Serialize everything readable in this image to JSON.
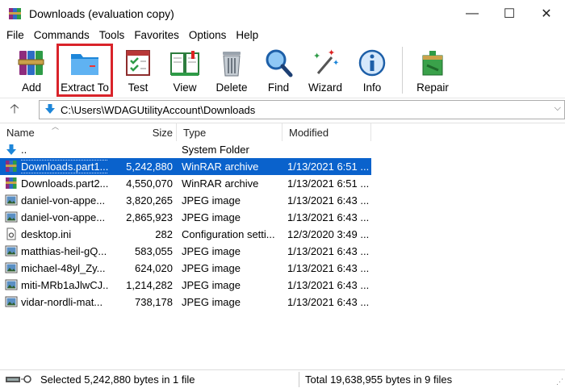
{
  "window": {
    "title": "Downloads (evaluation copy)",
    "minimize_glyph": "—",
    "maximize_glyph": "☐",
    "close_glyph": "✕"
  },
  "menu": [
    "File",
    "Commands",
    "Tools",
    "Favorites",
    "Options",
    "Help"
  ],
  "toolbar": [
    {
      "label": "Add",
      "icon": "books-archive-icon"
    },
    {
      "label": "Extract To",
      "icon": "folder-extract-icon",
      "highlighted": true
    },
    {
      "label": "Test",
      "icon": "checklist-icon"
    },
    {
      "label": "View",
      "icon": "open-book-icon"
    },
    {
      "label": "Delete",
      "icon": "trash-can-icon"
    },
    {
      "label": "Find",
      "icon": "magnifier-icon"
    },
    {
      "label": "Wizard",
      "icon": "magic-wand-icon"
    },
    {
      "label": "Info",
      "icon": "info-icon"
    },
    {
      "label": "Repair",
      "icon": "first-aid-box-icon"
    }
  ],
  "address": {
    "up_glyph": "🡡",
    "path": "C:\\Users\\WDAGUtilityAccount\\Downloads",
    "dropdown_glyph": "⌵"
  },
  "columns": {
    "name": "Name",
    "size": "Size",
    "type": "Type",
    "modified": "Modified"
  },
  "files": [
    {
      "name": "..",
      "size": "",
      "type": "System Folder",
      "modified": "",
      "icon": "folder-up-icon",
      "selected": false
    },
    {
      "name": "Downloads.part1...",
      "size": "5,242,880",
      "type": "WinRAR archive",
      "modified": "1/13/2021 6:51 ...",
      "icon": "rar-archive-icon",
      "selected": true
    },
    {
      "name": "Downloads.part2...",
      "size": "4,550,070",
      "type": "WinRAR archive",
      "modified": "1/13/2021 6:51 ...",
      "icon": "rar-archive-icon",
      "selected": false
    },
    {
      "name": "daniel-von-appe...",
      "size": "3,820,265",
      "type": "JPEG image",
      "modified": "1/13/2021 6:43 ...",
      "icon": "image-file-icon",
      "selected": false
    },
    {
      "name": "daniel-von-appe...",
      "size": "2,865,923",
      "type": "JPEG image",
      "modified": "1/13/2021 6:43 ...",
      "icon": "image-file-icon",
      "selected": false
    },
    {
      "name": "desktop.ini",
      "size": "282",
      "type": "Configuration setti...",
      "modified": "12/3/2020 3:49 ...",
      "icon": "config-file-icon",
      "selected": false
    },
    {
      "name": "matthias-heil-gQ...",
      "size": "583,055",
      "type": "JPEG image",
      "modified": "1/13/2021 6:43 ...",
      "icon": "image-file-icon",
      "selected": false
    },
    {
      "name": "michael-48yl_Zy...",
      "size": "624,020",
      "type": "JPEG image",
      "modified": "1/13/2021 6:43 ...",
      "icon": "image-file-icon",
      "selected": false
    },
    {
      "name": "miti-MRb1aJlwCJ...",
      "size": "1,214,282",
      "type": "JPEG image",
      "modified": "1/13/2021 6:43 ...",
      "icon": "image-file-icon",
      "selected": false
    },
    {
      "name": "vidar-nordli-mat...",
      "size": "738,178",
      "type": "JPEG image",
      "modified": "1/13/2021 6:43 ...",
      "icon": "image-file-icon",
      "selected": false
    }
  ],
  "status": {
    "left": "Selected 5,242,880 bytes in 1 file",
    "right": "Total 19,638,955 bytes in 9 files"
  },
  "colors": {
    "selection": "#0a62cc",
    "highlight_box": "#d9232a"
  }
}
